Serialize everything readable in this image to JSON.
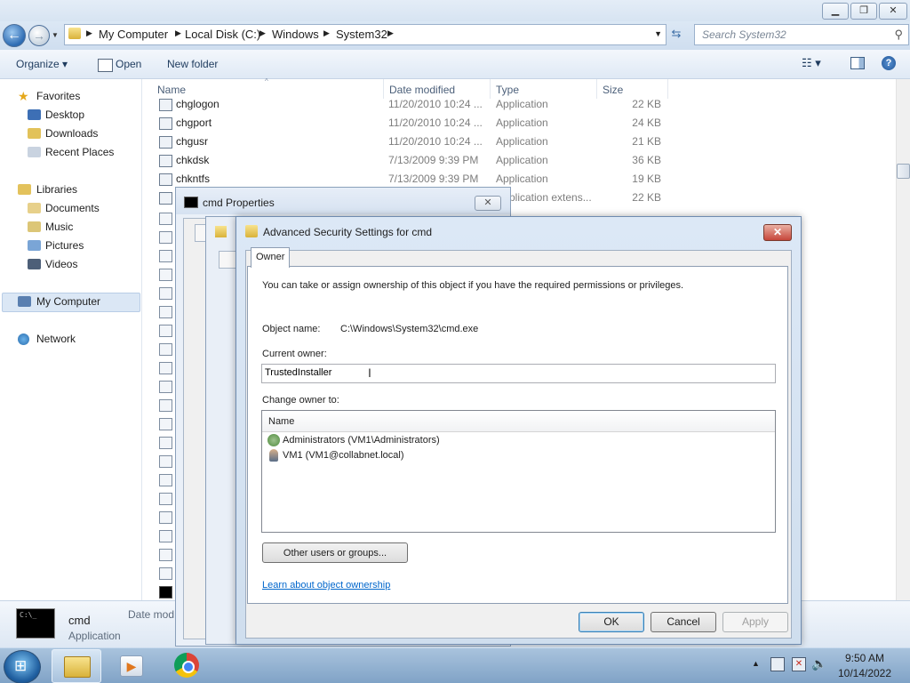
{
  "explorer": {
    "breadcrumb": [
      "My Computer",
      "Local Disk (C:)",
      "Windows",
      "System32"
    ],
    "search_placeholder": "Search System32",
    "toolbar": {
      "organize": "Organize",
      "open": "Open",
      "new_folder": "New folder"
    },
    "nav": {
      "favorites": "Favorites",
      "desktop": "Desktop",
      "downloads": "Downloads",
      "recent_places": "Recent Places",
      "libraries": "Libraries",
      "documents": "Documents",
      "music": "Music",
      "pictures": "Pictures",
      "videos": "Videos",
      "my_computer": "My Computer",
      "network": "Network"
    },
    "columns": {
      "name": "Name",
      "date": "Date modified",
      "type": "Type",
      "size": "Size"
    },
    "files": [
      {
        "name": "chglogon",
        "date": "11/20/2010 10:24 ...",
        "type": "Application",
        "size": "22 KB"
      },
      {
        "name": "chgport",
        "date": "11/20/2010 10:24 ...",
        "type": "Application",
        "size": "24 KB"
      },
      {
        "name": "chgusr",
        "date": "11/20/2010 10:24 ...",
        "type": "Application",
        "size": "21 KB"
      },
      {
        "name": "chkdsk",
        "date": "7/13/2009 9:39 PM",
        "type": "Application",
        "size": "36 KB"
      },
      {
        "name": "chkntfs",
        "date": "7/13/2009 9:39 PM",
        "type": "Application",
        "size": "19 KB"
      }
    ],
    "partial_row": {
      "type": "plication extens...",
      "size": "22 KB"
    },
    "details": {
      "name": "cmd",
      "type": "Application",
      "date_label": "Date mod"
    }
  },
  "cmd_properties": {
    "title": "cmd Properties"
  },
  "advanced_security": {
    "title": "Advanced Security Settings for cmd",
    "tab": "Owner",
    "intro": "You can take or assign ownership of this object if you have the required permissions or privileges.",
    "object_name_label": "Object name:",
    "object_name_value": "C:\\Windows\\System32\\cmd.exe",
    "current_owner_label": "Current owner:",
    "current_owner_value": "TrustedInstaller",
    "change_owner_label": "Change owner to:",
    "list_header": "Name",
    "owners": [
      "Administrators (VM1\\Administrators)",
      "VM1 (VM1@collabnet.local)"
    ],
    "other_users_button": "Other users or groups...",
    "learn_link": "Learn about object ownership",
    "ok": "OK",
    "cancel": "Cancel",
    "apply": "Apply"
  },
  "taskbar": {
    "time": "9:50 AM",
    "date": "10/14/2022"
  },
  "colors": {
    "accent": "#3c7fb1",
    "link": "#0066cc",
    "taskbar": "#8fb0d2"
  }
}
